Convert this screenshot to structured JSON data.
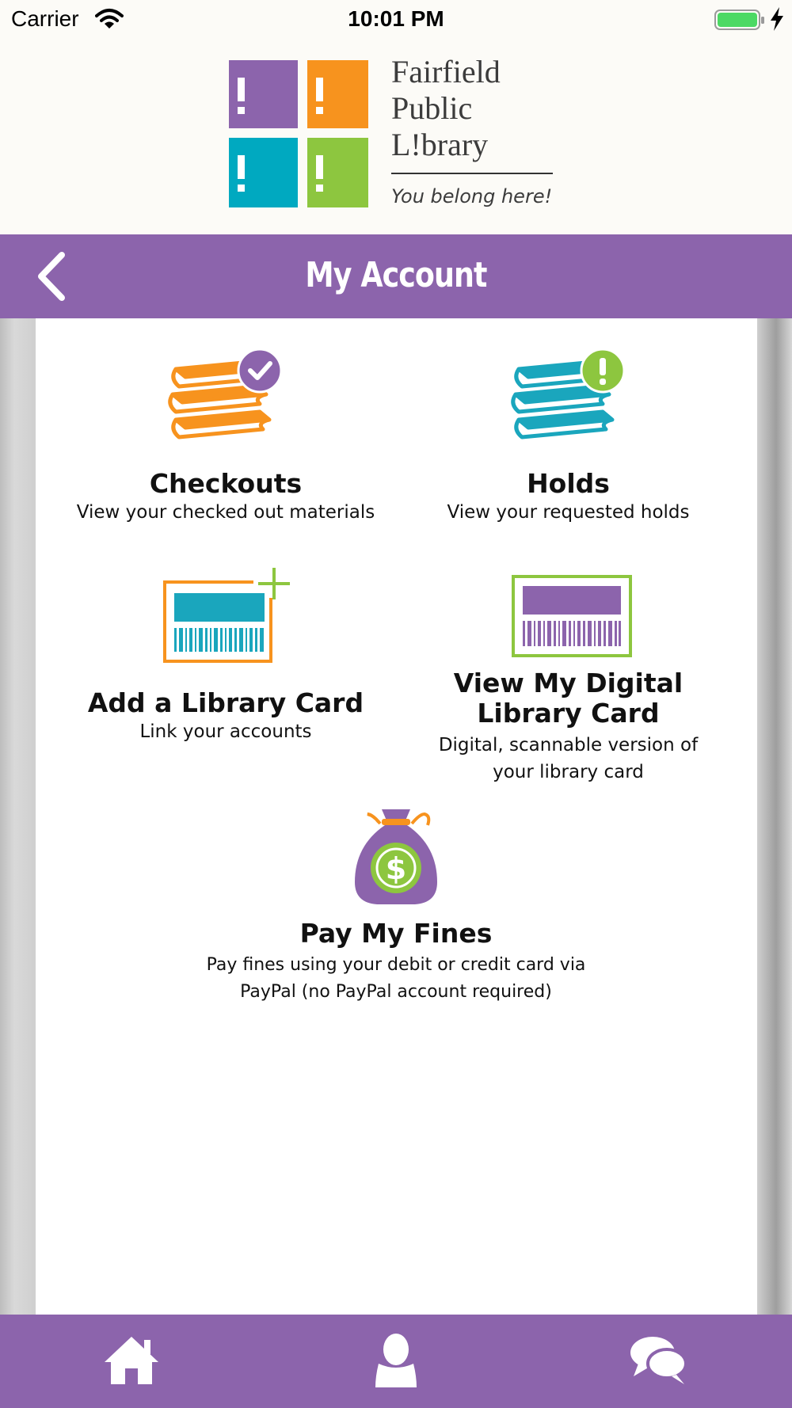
{
  "status_bar": {
    "carrier": "Carrier",
    "time": "10:01 PM",
    "battery_color": "#4cd964"
  },
  "logo": {
    "line1": "Fairfield",
    "line2": "Public",
    "line3": "L!brary",
    "tagline": "You belong here!",
    "colors": [
      "#8c64ac",
      "#f7931e",
      "#00a9c0",
      "#8dc63f"
    ]
  },
  "header": {
    "back_icon": "chevron-left-icon",
    "title": "My Account",
    "color": "#8c64ac"
  },
  "tiles": [
    {
      "id": "checkouts",
      "title": "Checkouts",
      "subtitle": "View your checked out materials",
      "icon": "books-check-icon"
    },
    {
      "id": "holds",
      "title": "Holds",
      "subtitle": "View your requested holds",
      "icon": "books-alert-icon"
    },
    {
      "id": "add_card",
      "title": "Add a Library Card",
      "subtitle": "Link your accounts",
      "icon": "card-add-icon"
    },
    {
      "id": "digital_card",
      "title_line1": "View My Digital",
      "title_line2": "Library Card",
      "subtitle_line1": "Digital, scannable version of",
      "subtitle_line2": "your library card",
      "icon": "barcode-card-icon"
    },
    {
      "id": "fines",
      "title": "Pay My Fines",
      "subtitle_line1": "Pay fines using your debit or credit card via",
      "subtitle_line2": "PayPal (no PayPal account required)",
      "icon": "money-bag-icon"
    }
  ],
  "tab_bar": {
    "items": [
      "home-icon",
      "user-icon",
      "chat-icon"
    ]
  }
}
